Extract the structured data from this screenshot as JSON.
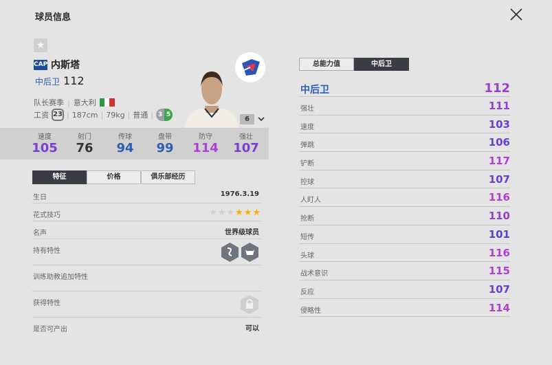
{
  "window": {
    "title": "球员信息"
  },
  "player": {
    "season_badge": "CAP",
    "name": "内斯塔",
    "position": "中后卫",
    "ovr": "112",
    "season": "队长赛季",
    "nationality": "意大利",
    "salary_label": "工资",
    "salary": "23",
    "height": "187cm",
    "weight": "79kg",
    "body_type": "普通",
    "weak_foot": "3",
    "strong_foot": "5",
    "level": "6"
  },
  "stats": [
    {
      "label": "速度",
      "value": "105",
      "color": "#7a3fd1"
    },
    {
      "label": "射门",
      "value": "76",
      "color": "#333333"
    },
    {
      "label": "传球",
      "value": "94",
      "color": "#2d5bb5"
    },
    {
      "label": "盘带",
      "value": "99",
      "color": "#2d5bb5"
    },
    {
      "label": "防守",
      "value": "114",
      "color": "#b03fd6"
    },
    {
      "label": "强壮",
      "value": "107",
      "color": "#7a3fd1"
    }
  ],
  "left_tabs": [
    "特征",
    "价格",
    "俱乐部经历"
  ],
  "details": {
    "birthday_label": "生日",
    "birthday": "1976.3.19",
    "skill_label": "花式技巧",
    "skill_stars": 3,
    "skill_stars_max": 6,
    "fame_label": "名声",
    "fame": "世界级球员",
    "traits_label": "持有特性",
    "coach_traits_label": "训练助教追加特性",
    "gained_traits_label": "获得特性",
    "can_produce_label": "是否可产出",
    "can_produce": "可以"
  },
  "right_tabs": [
    "总能力值",
    "中后卫"
  ],
  "rating_head": {
    "label": "中后卫",
    "value": "112"
  },
  "attributes": [
    {
      "label": "强壮",
      "value": "111",
      "color": "#8f3fd4"
    },
    {
      "label": "速度",
      "value": "103",
      "color": "#6a3fd0"
    },
    {
      "label": "弹跳",
      "value": "106",
      "color": "#6a3fd0"
    },
    {
      "label": "铲断",
      "value": "117",
      "color": "#b03fd6"
    },
    {
      "label": "控球",
      "value": "107",
      "color": "#6a3fd0"
    },
    {
      "label": "人盯人",
      "value": "116",
      "color": "#b03fd6"
    },
    {
      "label": "抢断",
      "value": "110",
      "color": "#8f3fd4"
    },
    {
      "label": "短传",
      "value": "101",
      "color": "#5a3fcd"
    },
    {
      "label": "头球",
      "value": "116",
      "color": "#b03fd6"
    },
    {
      "label": "战术意识",
      "value": "115",
      "color": "#b03fd6"
    },
    {
      "label": "反应",
      "value": "107",
      "color": "#6a3fd0"
    },
    {
      "label": "侵略性",
      "value": "114",
      "color": "#b03fd6"
    }
  ]
}
